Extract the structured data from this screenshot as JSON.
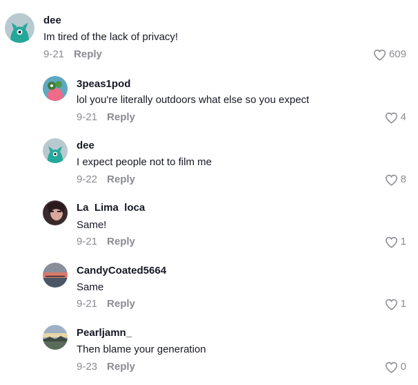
{
  "comments": [
    {
      "username": "dee",
      "text": "Im tired of the lack of privacy!",
      "date": "9-21",
      "reply_label": "Reply",
      "likes": "609",
      "avatar_icon": "teal-creature-avatar"
    },
    {
      "username": "3peas1pod",
      "text": "lol you're literally outdoors what else so you expect",
      "date": "9-21",
      "reply_label": "Reply",
      "likes": "4",
      "avatar_icon": "cartoon-avatar"
    },
    {
      "username": "dee",
      "text": "I expect people not to film me",
      "date": "9-22",
      "reply_label": "Reply",
      "likes": "8",
      "avatar_icon": "teal-creature-avatar"
    },
    {
      "username": "La  Lima  loca",
      "text": "Same!",
      "date": "9-21",
      "reply_label": "Reply",
      "likes": "1",
      "avatar_icon": "photo-avatar"
    },
    {
      "username": "CandyCoated5664",
      "text": "Same",
      "date": "9-21",
      "reply_label": "Reply",
      "likes": "1",
      "avatar_icon": "sunset-avatar"
    },
    {
      "username": "Pearljamn_",
      "text": "Then blame your generation",
      "date": "9-23",
      "reply_label": "Reply",
      "likes": "0",
      "avatar_icon": "landscape-avatar"
    }
  ],
  "colors": {
    "muted": "#8a8b91",
    "text": "#161823",
    "avatar_teal": "#23a89a"
  }
}
